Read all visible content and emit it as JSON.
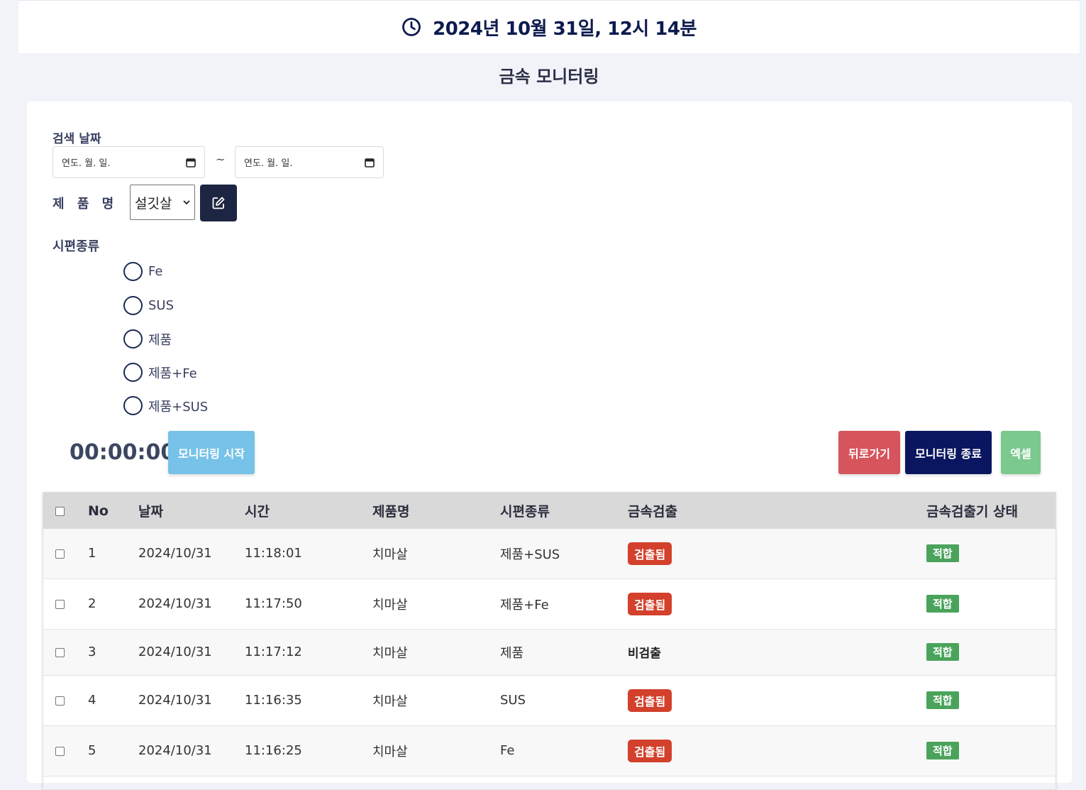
{
  "header": {
    "datetime": "2024년 10월 31일, 12시 14분",
    "icon": "clock-icon"
  },
  "page_title": "금속 모니터링",
  "filters": {
    "date_label": "검색 날짜",
    "date_start_placeholder": "연도. 월. 일.",
    "date_separator": "~",
    "date_end_placeholder": "연도. 월. 일.",
    "product_label": "제 품 명",
    "product_selected": "설깃살",
    "sample_label": "시편종류",
    "sample_options": [
      "Fe",
      "SUS",
      "제품",
      "제품+Fe",
      "제품+SUS"
    ]
  },
  "controls": {
    "timer": "00:00:00",
    "start_label": "모니터링 시작",
    "back_label": "뒤로가기",
    "stop_label": "모니터링 종료",
    "excel_label": "엑셀"
  },
  "colors": {
    "start": "#76c2e8",
    "back": "#d6545c",
    "stop": "#0b1660",
    "excel": "#7cc98f",
    "detected": "#d3402b",
    "ok": "#4aa35b"
  },
  "table": {
    "columns": [
      "No",
      "날짜",
      "시간",
      "제품명",
      "시편종류",
      "금속검출",
      "금속검출기 상태"
    ],
    "rows": [
      {
        "no": "1",
        "date": "2024/10/31",
        "time": "11:18:01",
        "product": "치마살",
        "sample": "제품+SUS",
        "detect": "검출됨",
        "status": "적합"
      },
      {
        "no": "2",
        "date": "2024/10/31",
        "time": "11:17:50",
        "product": "치마살",
        "sample": "제품+Fe",
        "detect": "검출됨",
        "status": "적합"
      },
      {
        "no": "3",
        "date": "2024/10/31",
        "time": "11:17:12",
        "product": "치마살",
        "sample": "제품",
        "detect": "비검출",
        "status": "적합"
      },
      {
        "no": "4",
        "date": "2024/10/31",
        "time": "11:16:35",
        "product": "치마살",
        "sample": "SUS",
        "detect": "검출됨",
        "status": "적합"
      },
      {
        "no": "5",
        "date": "2024/10/31",
        "time": "11:16:25",
        "product": "치마살",
        "sample": "Fe",
        "detect": "검출됨",
        "status": "적합"
      }
    ]
  }
}
